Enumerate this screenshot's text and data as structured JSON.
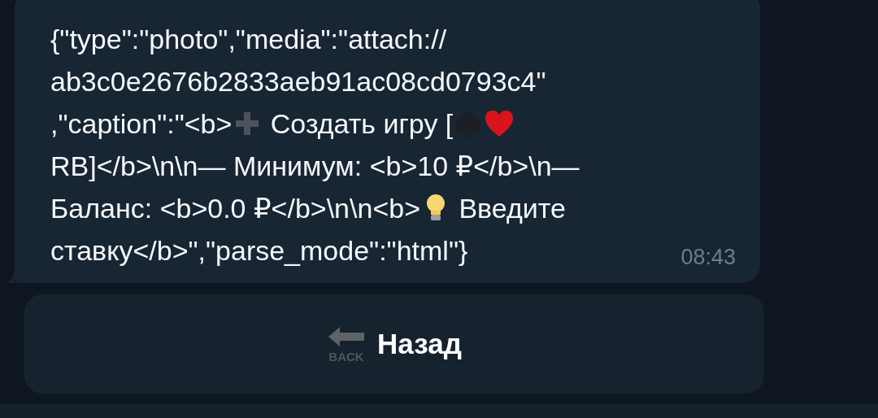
{
  "message": {
    "lines": [
      [
        {
          "kind": "text",
          "text": "{\"type\":\"photo\",\"media\":\"attach://"
        }
      ],
      [
        {
          "kind": "text",
          "text": "ab3c0e2676b2833aeb91ac08cd0793c4\""
        }
      ],
      [
        {
          "kind": "text",
          "text": ",\"caption\":\"<b>"
        },
        {
          "kind": "plus"
        },
        {
          "kind": "text",
          "text": " Создать игру ["
        },
        {
          "kind": "spade"
        },
        {
          "kind": "heart"
        }
      ],
      [
        {
          "kind": "text",
          "text": "RB]</b>\\n\\n— Минимум: <b>10 ₽</b>\\n—"
        }
      ],
      [
        {
          "kind": "text",
          "text": "Баланс: <b>0.0 ₽</b>\\n\\n<b>"
        },
        {
          "kind": "bulb"
        },
        {
          "kind": "text",
          "text": " Введите"
        }
      ],
      [
        {
          "kind": "text",
          "text": "ставку</b>\",\"parse_mode\":\"html\"}"
        }
      ]
    ],
    "time": "08:43"
  },
  "keyboard": [
    {
      "icon_caption": "BACK",
      "label": "Назад"
    }
  ]
}
